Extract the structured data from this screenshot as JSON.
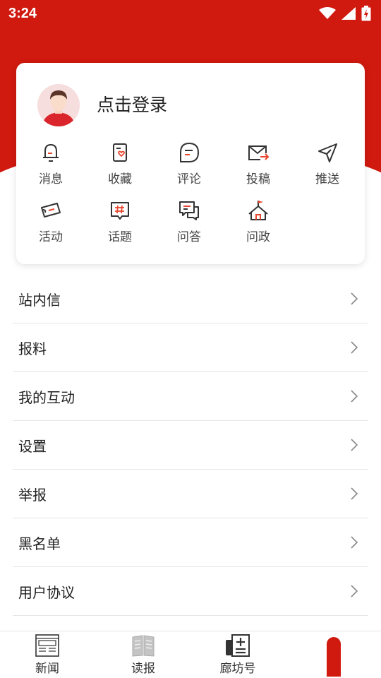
{
  "status_bar": {
    "time": "3:24"
  },
  "profile": {
    "login_label": "点击登录"
  },
  "quick_actions": [
    {
      "label": "消息",
      "icon": "bell-icon"
    },
    {
      "label": "收藏",
      "icon": "favorite-doc-icon"
    },
    {
      "label": "评论",
      "icon": "comment-icon"
    },
    {
      "label": "投稿",
      "icon": "submit-mail-icon"
    },
    {
      "label": "推送",
      "icon": "send-icon"
    },
    {
      "label": "活动",
      "icon": "ticket-icon"
    },
    {
      "label": "话题",
      "icon": "hashtag-icon"
    },
    {
      "label": "问答",
      "icon": "qa-icon"
    },
    {
      "label": "问政",
      "icon": "government-icon"
    }
  ],
  "menu": [
    {
      "label": "站内信"
    },
    {
      "label": "报料"
    },
    {
      "label": "我的互动"
    },
    {
      "label": "设置"
    },
    {
      "label": "举报"
    },
    {
      "label": "黑名单"
    },
    {
      "label": "用户协议"
    }
  ],
  "tabbar": [
    {
      "label": "新闻",
      "icon": "news-icon"
    },
    {
      "label": "读报",
      "icon": "newspaper-icon"
    },
    {
      "label": "廊坊号",
      "icon": "account-icon"
    },
    {
      "label": "",
      "icon": "profile-icon"
    }
  ],
  "colors": {
    "brand_red": "#d0190f",
    "icon_accent": "#e8462e"
  }
}
